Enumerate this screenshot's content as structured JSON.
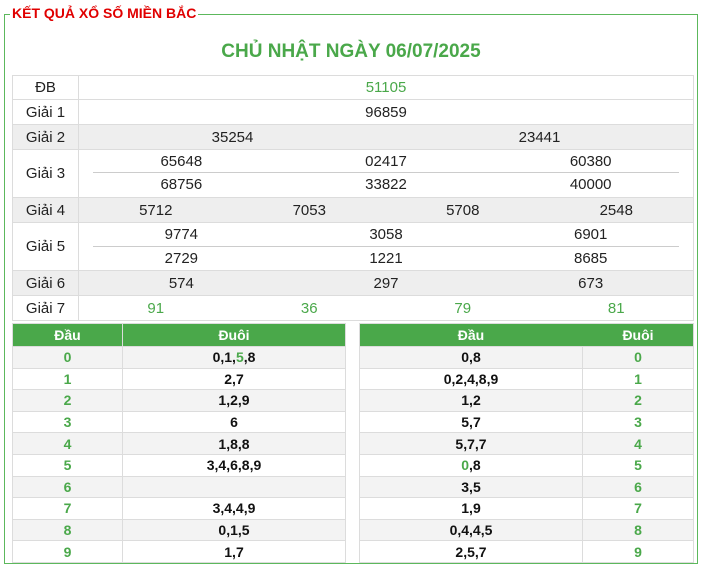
{
  "header": {
    "title": "KẾT QUẢ XỔ SỐ MIỀN BẮC",
    "date_title": "CHỦ NHẬT NGÀY 06/07/2025"
  },
  "prizes": {
    "db": {
      "label": "ĐB",
      "values": [
        "51105"
      ]
    },
    "g1": {
      "label": "Giải 1",
      "values": [
        "96859"
      ]
    },
    "g2": {
      "label": "Giải 2",
      "values": [
        "35254",
        "23441"
      ]
    },
    "g3": {
      "label": "Giải 3",
      "values": [
        "65648",
        "02417",
        "60380",
        "68756",
        "33822",
        "40000"
      ]
    },
    "g4": {
      "label": "Giải 4",
      "values": [
        "5712",
        "7053",
        "5708",
        "2548"
      ]
    },
    "g5": {
      "label": "Giải 5",
      "values": [
        "9774",
        "3058",
        "6901",
        "2729",
        "1221",
        "8685"
      ]
    },
    "g6": {
      "label": "Giải 6",
      "values": [
        "574",
        "297",
        "673"
      ]
    },
    "g7": {
      "label": "Giải 7",
      "values": [
        "91",
        "36",
        "79",
        "81"
      ]
    }
  },
  "dau_table": {
    "col_dau": "Đầu",
    "col_duoi": "Đuôi",
    "rows": [
      {
        "d": "0",
        "pre": "0,1,",
        "hl": "5",
        "post": ",8"
      },
      {
        "d": "1",
        "pre": "2,7",
        "hl": "",
        "post": ""
      },
      {
        "d": "2",
        "pre": "1,2,9",
        "hl": "",
        "post": ""
      },
      {
        "d": "3",
        "pre": "6",
        "hl": "",
        "post": ""
      },
      {
        "d": "4",
        "pre": "1,8,8",
        "hl": "",
        "post": ""
      },
      {
        "d": "5",
        "pre": "3,4,6,8,9",
        "hl": "",
        "post": ""
      },
      {
        "d": "6",
        "pre": "",
        "hl": "",
        "post": ""
      },
      {
        "d": "7",
        "pre": "3,4,4,9",
        "hl": "",
        "post": ""
      },
      {
        "d": "8",
        "pre": "0,1,5",
        "hl": "",
        "post": ""
      },
      {
        "d": "9",
        "pre": "1,7",
        "hl": "",
        "post": ""
      }
    ]
  },
  "duoi_table": {
    "col_dau": "Đầu",
    "col_duoi": "Đuôi",
    "rows": [
      {
        "d": "0",
        "pre": "",
        "hl": "",
        "post": "0,8"
      },
      {
        "d": "1",
        "pre": "",
        "hl": "",
        "post": "0,2,4,8,9"
      },
      {
        "d": "2",
        "pre": "",
        "hl": "",
        "post": "1,2"
      },
      {
        "d": "3",
        "pre": "",
        "hl": "",
        "post": "5,7"
      },
      {
        "d": "4",
        "pre": "",
        "hl": "",
        "post": "5,7,7"
      },
      {
        "d": "5",
        "pre": "",
        "hl": "0",
        "post": ",8"
      },
      {
        "d": "6",
        "pre": "",
        "hl": "",
        "post": "3,5"
      },
      {
        "d": "7",
        "pre": "",
        "hl": "",
        "post": "1,9"
      },
      {
        "d": "8",
        "pre": "",
        "hl": "",
        "post": "0,4,4,5"
      },
      {
        "d": "9",
        "pre": "",
        "hl": "",
        "post": "2,5,7"
      }
    ]
  },
  "colors": {
    "accent_green": "#4aa84a",
    "title_red": "#e00000"
  }
}
